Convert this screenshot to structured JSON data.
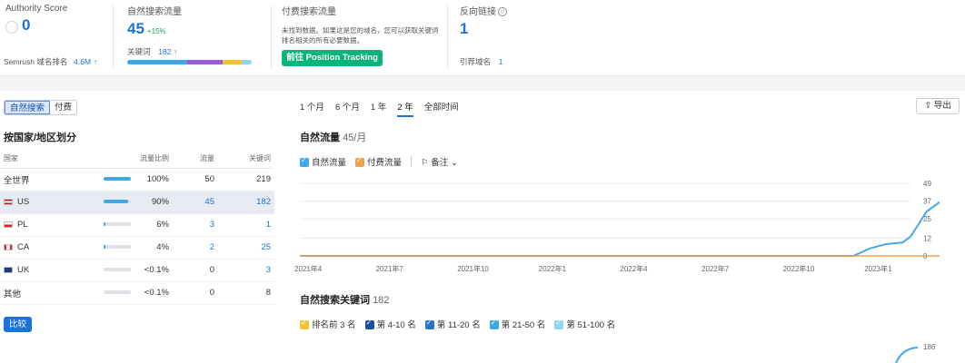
{
  "metrics": {
    "authority": {
      "label": "Authority Score",
      "value": "0",
      "rank_label": "Semrush 域名排名",
      "rank_value": "4.6M",
      "rank_arrow": "↑"
    },
    "organic": {
      "label": "自然搜索流量",
      "value": "45",
      "change": "+15%",
      "kw_label": "关键词",
      "kw_value": "182",
      "kw_arrow": "↑"
    },
    "paid": {
      "label": "付费搜索流量",
      "desc": "未找到数据。如果这是您的域名，您可以获取关键词排名相关的所有必要数据。",
      "button": "前往 Position Tracking"
    },
    "backlinks": {
      "label": "反向链接",
      "value": "1",
      "ref_label": "引荐域名",
      "ref_value": "1"
    }
  },
  "left": {
    "toggle": [
      "自然搜索",
      "付费"
    ],
    "section_title": "按国家/地区划分",
    "headers": [
      "国家",
      "流量比例",
      "流量",
      "关键词"
    ],
    "rows": [
      {
        "country": "全世界",
        "share": "100%",
        "share_num": 1.0,
        "traffic": "50",
        "keywords": "219",
        "flag": ""
      },
      {
        "country": "US",
        "share": "90%",
        "share_num": 0.9,
        "traffic": "45",
        "keywords": "182",
        "flag": "us"
      },
      {
        "country": "PL",
        "share": "6%",
        "share_num": 0.06,
        "traffic": "3",
        "keywords": "1",
        "flag": "pl"
      },
      {
        "country": "CA",
        "share": "4%",
        "share_num": 0.04,
        "traffic": "2",
        "keywords": "25",
        "flag": "ca"
      },
      {
        "country": "UK",
        "share": "<0.1%",
        "share_num": 0.0,
        "traffic": "0",
        "keywords": "3",
        "flag": "uk"
      },
      {
        "country": "其他",
        "share": "<0.1%",
        "share_num": 0.0,
        "traffic": "0",
        "keywords": "8",
        "flag": ""
      }
    ],
    "compare_button": "比较"
  },
  "right": {
    "ranges": [
      "1 个月",
      "6 个月",
      "1 年",
      "2 年",
      "全部时间"
    ],
    "selected_range": "2 年",
    "export_label": "导出",
    "traffic_title": "自然流量",
    "traffic_sub": "45/月",
    "traffic_legend": {
      "organic": "自然流量",
      "paid": "付费流量",
      "notes": "备注"
    },
    "keywords_title": "自然搜索关键词",
    "keywords_count": "182",
    "kw_legend": [
      "排名前 3 名",
      "第 4-10 名",
      "第 11-20 名",
      "第 21-50 名",
      "第 51-100 名"
    ],
    "kw_axis_top": "186"
  },
  "chart_data": {
    "type": "line",
    "x_ticks": [
      "2021年4",
      "2021年7",
      "2021年10",
      "2022年1",
      "2022年4",
      "2022年7",
      "2022年10",
      "2023年1"
    ],
    "y_ticks": [
      0,
      12,
      25,
      37,
      49
    ],
    "ylim": [
      0,
      49
    ],
    "series": [
      {
        "name": "自然流量",
        "color": "#3fa9e8",
        "x": [
          0,
          0.5,
          1,
          1.5,
          2,
          2.5,
          3,
          3.5,
          4,
          4.5,
          5,
          5.5,
          6,
          6.5,
          6.8,
          7.0,
          7.2,
          7.4,
          7.5,
          7.7,
          7.9,
          8.1,
          8.3,
          8.5
        ],
        "values": [
          0,
          0,
          0,
          0,
          0,
          0,
          0,
          0,
          0,
          0,
          0,
          0,
          0,
          0,
          0,
          5,
          8,
          9,
          13,
          30,
          38,
          40,
          43,
          45
        ]
      },
      {
        "name": "付费流量",
        "color": "#f0a04b",
        "x": [
          0,
          8.5
        ],
        "values": [
          0,
          0
        ]
      }
    ]
  },
  "colors": {
    "accent": "#1a73d9",
    "green": "#0ab47a",
    "organic": "#3fa9e8",
    "paid": "#f0a04b"
  }
}
